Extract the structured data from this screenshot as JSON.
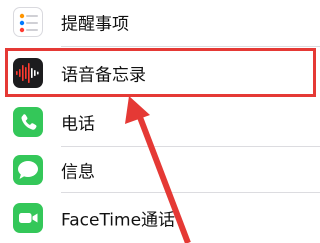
{
  "settings_list": {
    "items": [
      {
        "label": "提醒事项",
        "icon": "reminders-icon"
      },
      {
        "label": "语音备忘录",
        "icon": "voice-memos-icon"
      },
      {
        "label": "电话",
        "icon": "phone-icon"
      },
      {
        "label": "信息",
        "icon": "messages-icon"
      },
      {
        "label": "FaceTime通话",
        "icon": "facetime-icon"
      }
    ]
  },
  "annotation": {
    "highlight_color": "#e53935",
    "arrow_color": "#e53935"
  }
}
